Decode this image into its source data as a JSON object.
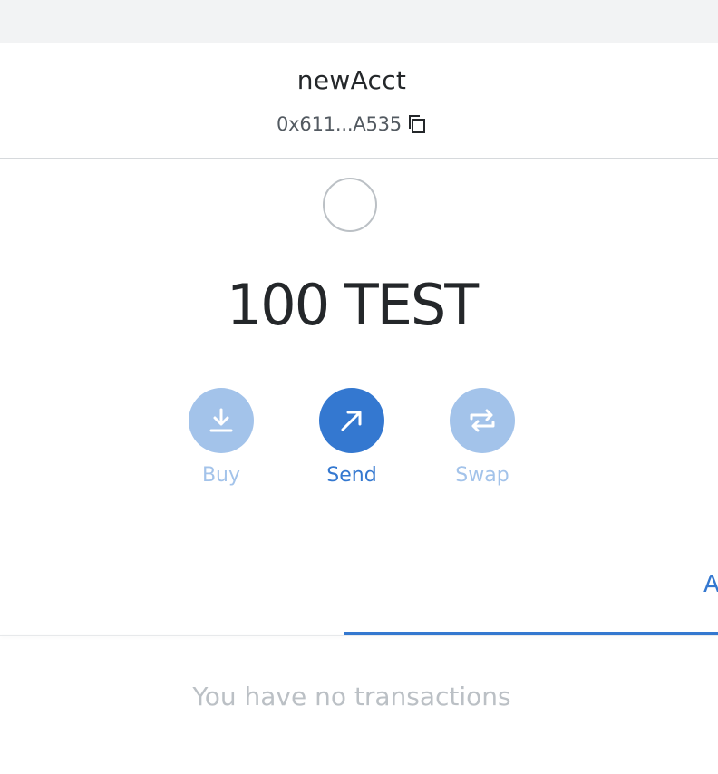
{
  "account": {
    "name": "newAcct",
    "address": "0x611...A535",
    "copy_icon": "copy-icon"
  },
  "balance": {
    "display": "100 TEST",
    "token_icon": "token-icon"
  },
  "actions": [
    {
      "label": "Buy",
      "icon": "download-icon",
      "state": "disabled"
    },
    {
      "label": "Send",
      "icon": "arrow-up-right-icon",
      "state": "enabled"
    },
    {
      "label": "Swap",
      "icon": "swap-arrows-icon",
      "state": "disabled"
    }
  ],
  "tabs": {
    "activity_partial": "A"
  },
  "activity": {
    "empty_message": "You have no transactions"
  },
  "colors": {
    "accent": "#3478d0",
    "accent_disabled": "#a3c3ea",
    "text_primary": "#24272a",
    "text_muted": "#bbc0c5"
  }
}
